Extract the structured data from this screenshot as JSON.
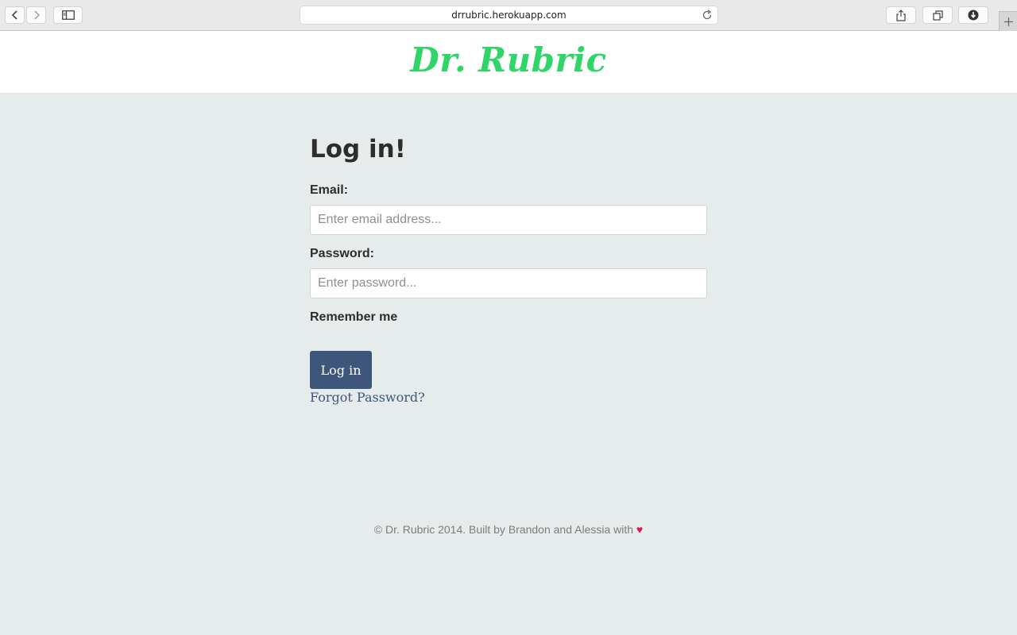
{
  "browser": {
    "url": "drrubric.herokuapp.com",
    "icons": {
      "back": "chevron-left-icon",
      "forward": "chevron-right-icon",
      "sidebar": "sidebar-icon",
      "reload": "reload-icon",
      "share": "share-icon",
      "tabs": "tabs-icon",
      "downloads": "download-icon",
      "new_tab": "plus-icon"
    }
  },
  "header": {
    "logo_text": "Dr. Rubric",
    "logo_color": "#2fd566"
  },
  "login": {
    "title": "Log in!",
    "email_label": "Email:",
    "email_value": "",
    "email_placeholder": "Enter email address...",
    "password_label": "Password:",
    "password_value": "",
    "password_placeholder": "Enter password...",
    "remember_label": "Remember me",
    "submit_label": "Log in",
    "forgot_label": "Forgot Password?"
  },
  "footer": {
    "text": "© Dr. Rubric 2014.  Built by Brandon and Alessia with ",
    "heart": "♥"
  },
  "colors": {
    "background": "#e6ecec",
    "primary": "#3d5679",
    "heart": "#e8104d"
  }
}
